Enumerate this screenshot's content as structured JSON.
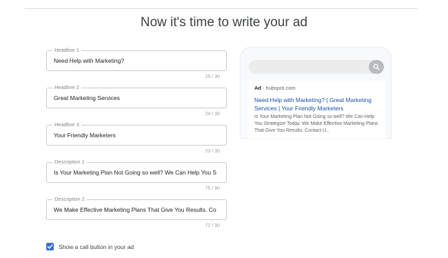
{
  "page": {
    "title": "Now it's time to write your ad"
  },
  "fields": [
    {
      "label": "Headline 1",
      "value": "Need Help with Marketing?",
      "counter": "25 / 30"
    },
    {
      "label": "Headline 2",
      "value": "Great Marketing Services",
      "counter": "24 / 30"
    },
    {
      "label": "Headline 3",
      "value": "Your Friendly Marketers",
      "counter": "23 / 30"
    },
    {
      "label": "Description 1",
      "value": "Is Your Marketing Plan Not Going so well? We Can Help You S",
      "counter": "75 / 90"
    },
    {
      "label": "Description 2",
      "value": "We Make Effective Marketing Plans That Give You Results. Co",
      "counter": "72 / 90"
    }
  ],
  "preview": {
    "ad_badge": "Ad",
    "separator": " · ",
    "domain": "hubspot.com",
    "headline": "Need Help with Marketing? | Great Marketing Services | Your Friendly Marketers",
    "description": "Is Your Marketing Plan Not Going so well? We Can Help You Strategize Today. We Make Effective Marketing Plans That Give You Results. Contact U..",
    "search_icon": "search-icon"
  },
  "call_option": {
    "label": "Show a call button in your ad",
    "checked": true
  },
  "colors": {
    "accent": "#3b6fd4",
    "link": "#1a4ea8"
  }
}
